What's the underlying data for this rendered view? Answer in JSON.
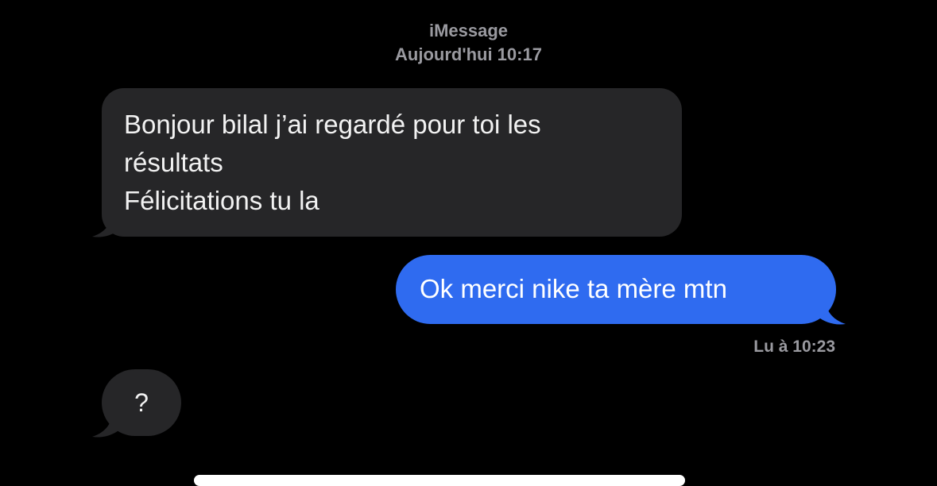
{
  "header": {
    "service": "iMessage",
    "timestamp": "Aujourd'hui 10:17"
  },
  "messages": [
    {
      "direction": "incoming",
      "lines": [
        "Bonjour bilal j’ai regardé pour toi les",
        "résultats",
        "Félicitations tu la"
      ]
    },
    {
      "direction": "outgoing",
      "lines": [
        "Ok merci nike ta mère mtn"
      ]
    },
    {
      "direction": "incoming",
      "lines": [
        "?"
      ]
    }
  ],
  "read_receipt": "Lu à 10:23",
  "colors": {
    "background": "#000000",
    "incoming_bubble": "#262628",
    "outgoing_bubble": "#2f6bf0",
    "meta_text": "#9a9aa0"
  }
}
